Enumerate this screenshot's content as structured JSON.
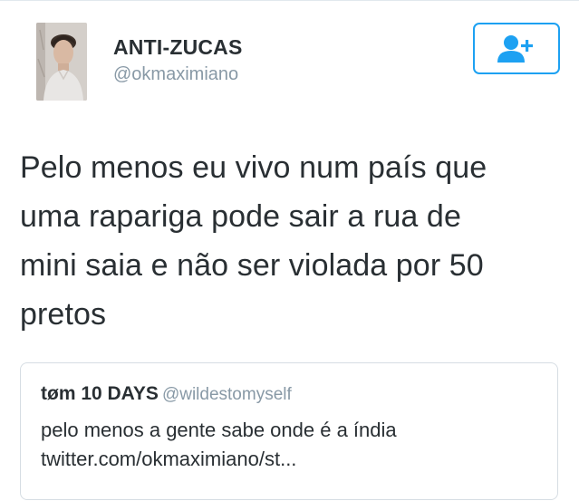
{
  "tweet": {
    "author": {
      "display_name": "ANTI-ZUCAS",
      "handle": "@okmaximiano",
      "avatar_icon": "profile-photo"
    },
    "follow_button": {
      "icon": "follow-user-plus-icon",
      "color": "#1da1f2"
    },
    "text_lines": [
      "Pelo menos eu vivo num país que",
      "uma rapariga pode sair a rua de",
      "mini saia e não ser violada por 50",
      "pretos"
    ],
    "quoted": {
      "name": "tøm 10 DAYS",
      "handle": "@wildestomyself",
      "text_lines": [
        "pelo menos a gente sabe onde é a índia",
        "twitter.com/okmaximiano/st..."
      ]
    }
  },
  "colors": {
    "primary_text": "#292f33",
    "secondary_text": "#8899a6",
    "accent": "#1da1f2",
    "border": "#d6dde3"
  }
}
